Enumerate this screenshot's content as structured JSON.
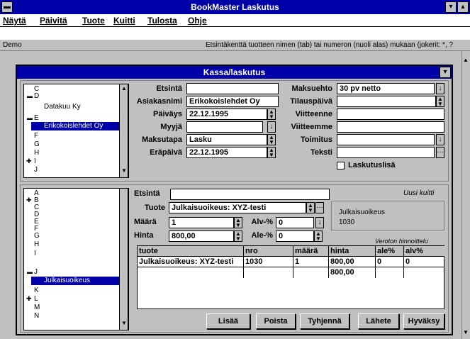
{
  "app": {
    "title": "BookMaster Laskutus"
  },
  "menu": [
    "Näytä",
    "Päivitä",
    "Tuote",
    "Kuitti",
    "Tulosta",
    "Ohje"
  ],
  "status": {
    "left": "Demo",
    "right": "Etsintäkenttä tuotteen nimen (tab) tai numeron (nuoli alas) mukaan  (jokerit: *, ?"
  },
  "window": {
    "title": "Kassa/laskutus"
  },
  "customers": {
    "items": [
      "C",
      "D",
      "Datakuu Ky",
      "E",
      "Erikokoislehdet Oy",
      "F",
      "G",
      "H",
      "I",
      "J"
    ],
    "selected": "Erikokoislehdet Oy"
  },
  "form": {
    "etsinta_label": "Etsintä",
    "etsinta_value": "",
    "asiakasnimi_label": "Asiakasnimi",
    "asiakasnimi_value": "Erikokoislehdet Oy",
    "paivays_label": "Päiväys",
    "paivays_value": "22.12.1995",
    "myyja_label": "Myyjä",
    "myyja_value": "",
    "maksutapa_label": "Maksutapa",
    "maksutapa_value": "Lasku",
    "erapaiva_label": "Eräpäivä",
    "erapaiva_value": "22.12.1995",
    "maksuehto_label": "Maksuehto",
    "maksuehto_value": "30 pv netto",
    "tilauspaiva_label": "Tilauspäivä",
    "tilauspaiva_value": "",
    "viitteenne_label": "Viitteenne",
    "viitteenne_value": "",
    "viitteemme_label": "Viitteemme",
    "viitteemme_value": "",
    "toimitus_label": "Toimitus",
    "toimitus_value": "",
    "teksti_label": "Teksti",
    "teksti_value": "",
    "laskutuslisa_label": "Laskutuslisä",
    "laskutuslisa_checked": false
  },
  "products": {
    "items": [
      "A",
      "B",
      "C",
      "D",
      "E",
      "F",
      "G",
      "H",
      "I",
      "J",
      "Julkaisuoikeus",
      "K",
      "L",
      "M",
      "N"
    ],
    "selected": "Julkaisuoikeus"
  },
  "line": {
    "etsinta_label": "Etsintä",
    "etsinta_value": "",
    "uusi_kuitti": "Uusi kuitti",
    "tuote_label": "Tuote",
    "tuote_value": "Julkaisuoikeus: XYZ-testi",
    "maara_label": "Määrä",
    "maara_value": "1",
    "hinta_label": "Hinta",
    "hinta_value": "800,00",
    "alv_label": "Alv-%",
    "alv_value": "0",
    "ale_label": "Ale-%",
    "ale_value": "0",
    "info_line1": "Julkaisuoikeus",
    "info_line2": "1030",
    "veroton": "Veroton hinnoittelu"
  },
  "table": {
    "columns": [
      "tuote",
      "nro",
      "määrä",
      "hinta",
      "ale%",
      "alv%"
    ],
    "rows": [
      [
        "Julkaisuoikeus: XYZ-testi",
        "1030",
        "1",
        "800,00",
        "0",
        "0"
      ]
    ],
    "total": "800,00"
  },
  "buttons": {
    "lisaa": "Lisää",
    "poista": "Poista",
    "tyhjenna": "Tyhjennä",
    "lahete": "Lähete",
    "hyvaksy": "Hyväksy"
  }
}
